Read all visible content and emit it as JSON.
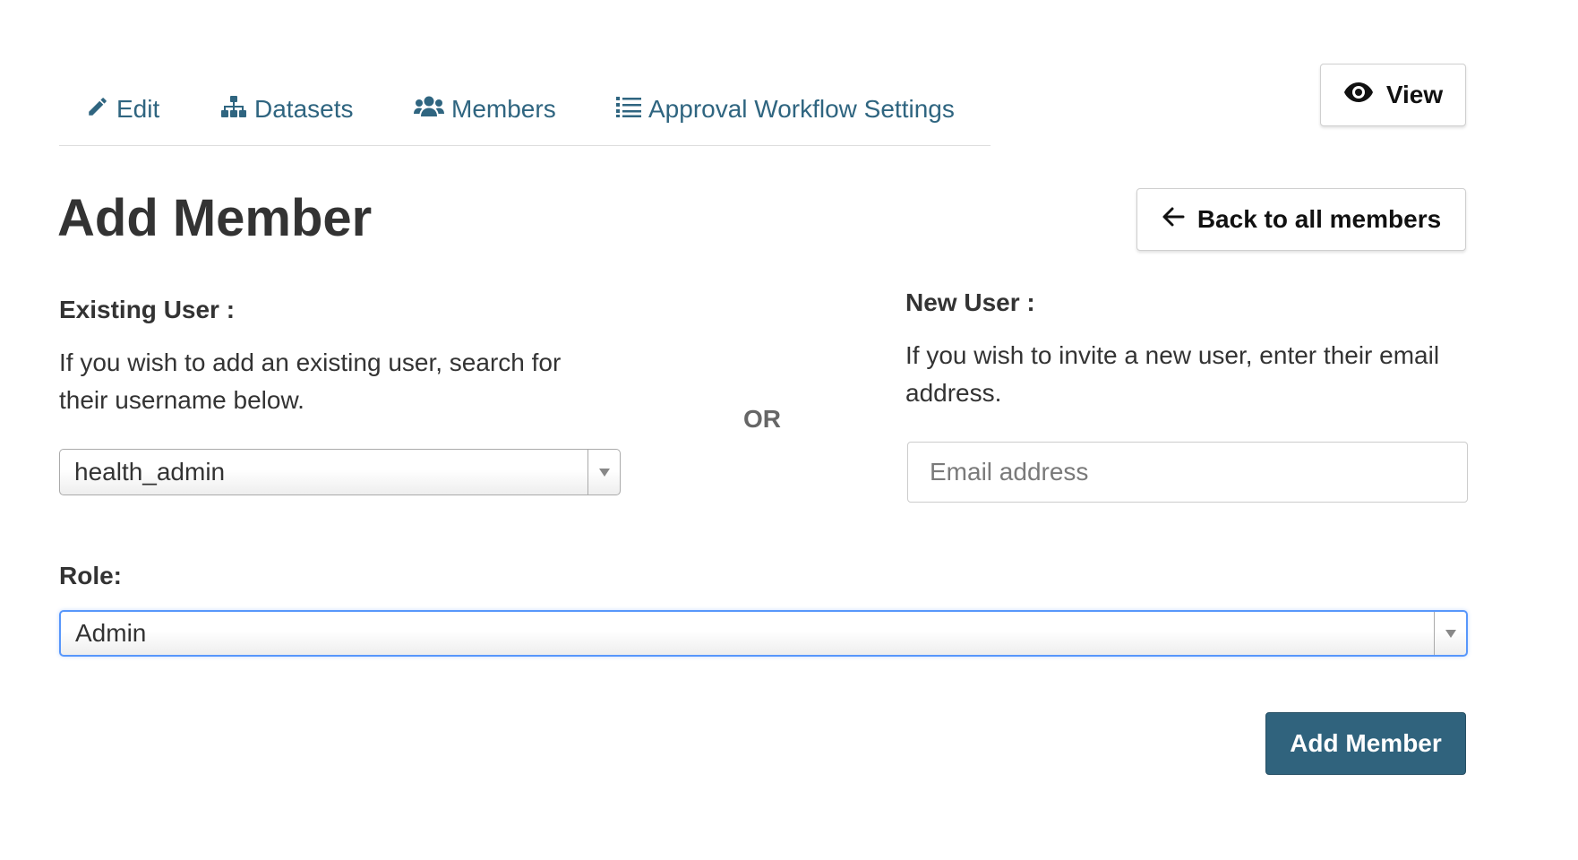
{
  "tabs": [
    {
      "label": "Edit",
      "icon": "pencil-icon"
    },
    {
      "label": "Datasets",
      "icon": "sitemap-icon"
    },
    {
      "label": "Members",
      "icon": "users-icon"
    },
    {
      "label": "Approval Workflow Settings",
      "icon": "list-icon"
    }
  ],
  "header": {
    "view_label": "View",
    "view_icon": "eye-icon"
  },
  "main": {
    "title": "Add Member",
    "back_label": "Back to all members",
    "back_icon": "arrow-left-icon",
    "existing_user": {
      "label": "Existing User :",
      "help": "If you wish to add an existing user, search for their username below.",
      "selected": "health_admin"
    },
    "or_text": "OR",
    "new_user": {
      "label": "New User :",
      "help": "If you wish to invite a new user, enter their email address.",
      "email_value": "",
      "email_placeholder": "Email address"
    },
    "role": {
      "label": "Role:",
      "selected": "Admin"
    },
    "submit_label": "Add Member"
  },
  "colors": {
    "link": "#2f6580",
    "primary_button": "#30637d",
    "focus_border": "#5897fb"
  }
}
